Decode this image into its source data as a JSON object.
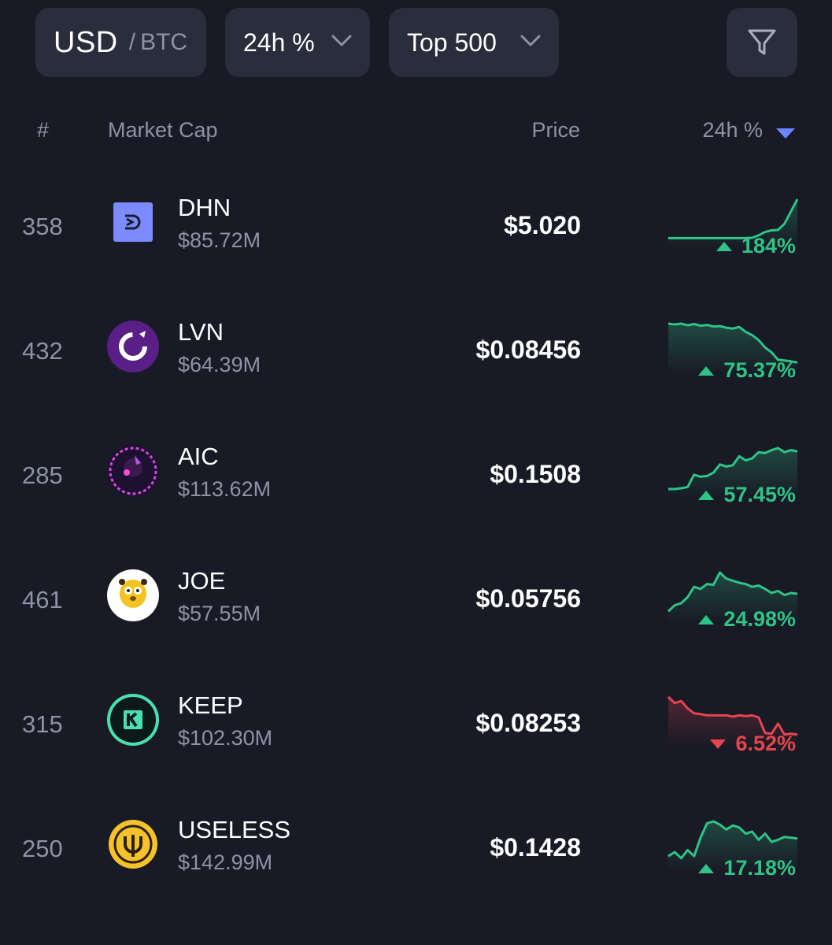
{
  "toolbar": {
    "currency": {
      "selected": "USD",
      "separator": "/",
      "alternate": "BTC"
    },
    "timeframe": {
      "label": "24h %"
    },
    "rank_filter": {
      "label": "Top 500"
    },
    "filter_icon": "filter-icon"
  },
  "columns": {
    "rank": "#",
    "market_cap": "Market Cap",
    "price": "Price",
    "change": "24h %",
    "sort_icon": "sort-desc-icon"
  },
  "colors": {
    "up": "#2fc386",
    "down": "#e4454f",
    "accent": "#6b84ff",
    "background": "#181a25"
  },
  "rows": [
    {
      "rank": "358",
      "symbol": "DHN",
      "market_cap": "$85.72M",
      "price": "$5.020",
      "change": "184%",
      "direction": "up",
      "logo_icon": "dhn-logo-icon",
      "spark": [
        0.05,
        0.05,
        0.05,
        0.05,
        0.05,
        0.05,
        0.05,
        0.05,
        0.05,
        0.05,
        0.05,
        0.05,
        0.05,
        0.06,
        0.12,
        0.2,
        0.24,
        0.25,
        0.4,
        0.7,
        1.0
      ]
    },
    {
      "rank": "432",
      "symbol": "LVN",
      "market_cap": "$64.39M",
      "price": "$0.08456",
      "change": "75.37%",
      "direction": "up",
      "logo_icon": "lvn-logo-icon",
      "spark": [
        1.0,
        0.98,
        1.0,
        0.96,
        0.99,
        0.95,
        0.97,
        0.93,
        0.94,
        0.9,
        0.88,
        0.92,
        0.8,
        0.72,
        0.6,
        0.42,
        0.3,
        0.12,
        0.1,
        0.08,
        0.05
      ]
    },
    {
      "rank": "285",
      "symbol": "AIC",
      "market_cap": "$113.62M",
      "price": "$0.1508",
      "change": "57.45%",
      "direction": "up",
      "logo_icon": "aic-logo-icon",
      "spark": [
        0.0,
        0.0,
        0.02,
        0.05,
        0.35,
        0.3,
        0.32,
        0.4,
        0.6,
        0.55,
        0.58,
        0.8,
        0.7,
        0.75,
        0.9,
        0.88,
        0.95,
        1.0,
        0.9,
        0.95,
        0.92
      ]
    },
    {
      "rank": "461",
      "symbol": "JOE",
      "market_cap": "$57.55M",
      "price": "$0.05756",
      "change": "24.98%",
      "direction": "up",
      "logo_icon": "joe-logo-icon",
      "spark": [
        0.05,
        0.2,
        0.25,
        0.4,
        0.65,
        0.6,
        0.72,
        0.7,
        1.0,
        0.85,
        0.8,
        0.75,
        0.72,
        0.65,
        0.68,
        0.6,
        0.5,
        0.55,
        0.45,
        0.5,
        0.48
      ]
    },
    {
      "rank": "315",
      "symbol": "KEEP",
      "market_cap": "$102.30M",
      "price": "$0.08253",
      "change": "6.52%",
      "direction": "down",
      "logo_icon": "keep-logo-icon",
      "spark": [
        1.0,
        0.85,
        0.9,
        0.72,
        0.6,
        0.58,
        0.55,
        0.55,
        0.55,
        0.55,
        0.52,
        0.55,
        0.53,
        0.55,
        0.5,
        0.12,
        0.1,
        0.35,
        0.08,
        0.1,
        0.08
      ]
    },
    {
      "rank": "250",
      "symbol": "USELESS",
      "market_cap": "$142.99M",
      "price": "$0.1428",
      "change": "17.18%",
      "direction": "up",
      "logo_icon": "useless-logo-icon",
      "spark": [
        0.15,
        0.25,
        0.1,
        0.3,
        0.15,
        0.6,
        0.95,
        1.0,
        0.92,
        0.8,
        0.9,
        0.85,
        0.7,
        0.75,
        0.55,
        0.7,
        0.5,
        0.55,
        0.62,
        0.6,
        0.58
      ]
    }
  ]
}
